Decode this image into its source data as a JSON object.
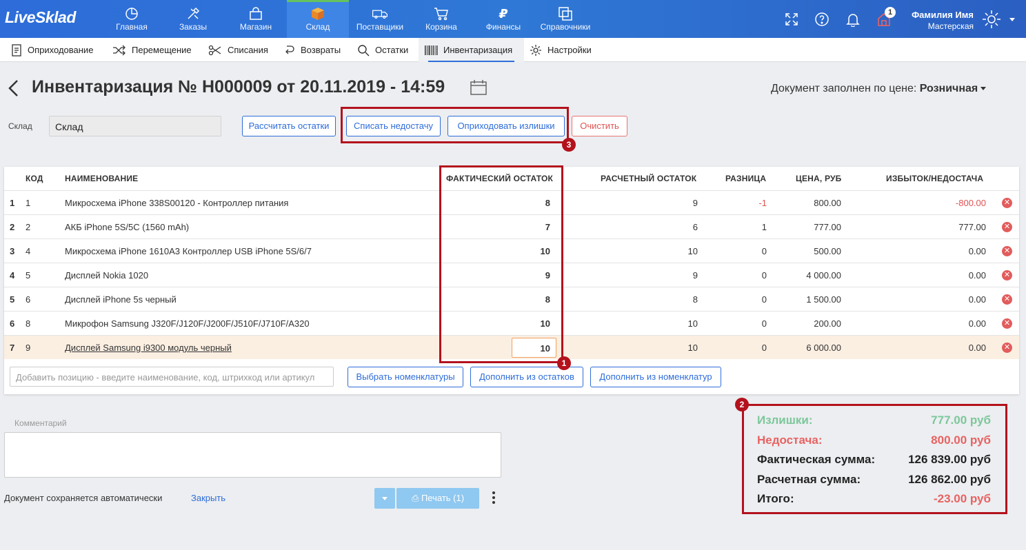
{
  "app": {
    "logo": "LiveSklad"
  },
  "nav": [
    {
      "label": "Главная",
      "icon": "chart-pie-icon"
    },
    {
      "label": "Заказы",
      "icon": "tools-icon"
    },
    {
      "label": "Магазин",
      "icon": "shopping-bag-icon"
    },
    {
      "label": "Склад",
      "icon": "box-icon",
      "active": true
    },
    {
      "label": "Поставщики",
      "icon": "truck-icon"
    },
    {
      "label": "Корзина",
      "icon": "cart-icon"
    },
    {
      "label": "Финансы",
      "icon": "ruble-icon"
    },
    {
      "label": "Справочники",
      "icon": "copy-icon"
    }
  ],
  "topright": {
    "notifications_count": "1",
    "user_name": "Фамилия Имя",
    "user_role": "Мастерская"
  },
  "subnav": [
    {
      "label": "Оприходование",
      "icon": "document-icon"
    },
    {
      "label": "Перемещение",
      "icon": "shuffle-icon"
    },
    {
      "label": "Списания",
      "icon": "scissors-icon"
    },
    {
      "label": "Возвраты",
      "icon": "return-icon"
    },
    {
      "label": "Остатки",
      "icon": "search-icon"
    },
    {
      "label": "Инвентаризация",
      "icon": "barcode-icon",
      "active": true
    },
    {
      "label": "Настройки",
      "icon": "gear-icon"
    }
  ],
  "page": {
    "title": "Инвентаризация № Н000009 от 20.11.2019 - 14:59",
    "price_label": "Документ заполнен по цене:",
    "price_value": "Розничная",
    "sklad_label": "Склад",
    "sklad_value": "Склад"
  },
  "actions": {
    "calc": "Рассчитать остатки",
    "writeoff": "Списать недостачу",
    "receive": "Оприходовать излишки",
    "clear": "Очистить"
  },
  "table": {
    "headers": {
      "code": "КОД",
      "name": "НАИМЕНОВАНИЕ",
      "actual": "ФАКТИЧЕСКИЙ ОСТАТОК",
      "calc": "РАСЧЕТНЫЙ ОСТАТОК",
      "diff": "РАЗНИЦА",
      "price": "ЦЕНА, РУБ",
      "surplus": "ИЗБЫТОК/НЕДОСТАЧА"
    },
    "rows": [
      {
        "n": "1",
        "code": "1",
        "name": "Микросхема iPhone 338S00120 - Контроллер питания",
        "actual": "8",
        "calc": "9",
        "diff": "-1",
        "price": "800.00",
        "surplus": "-800.00"
      },
      {
        "n": "2",
        "code": "2",
        "name": "АКБ iPhone 5S/5C (1560 mAh)",
        "actual": "7",
        "calc": "6",
        "diff": "1",
        "price": "777.00",
        "surplus": "777.00"
      },
      {
        "n": "3",
        "code": "4",
        "name": "Микросхема iPhone 1610A3 Контроллер USB iPhone 5S/6/7",
        "actual": "10",
        "calc": "10",
        "diff": "0",
        "price": "500.00",
        "surplus": "0.00"
      },
      {
        "n": "4",
        "code": "5",
        "name": "Дисплей Nokia 1020",
        "actual": "9",
        "calc": "9",
        "diff": "0",
        "price": "4 000.00",
        "surplus": "0.00"
      },
      {
        "n": "5",
        "code": "6",
        "name": "Дисплей iPhone 5s черный",
        "actual": "8",
        "calc": "8",
        "diff": "0",
        "price": "1 500.00",
        "surplus": "0.00"
      },
      {
        "n": "6",
        "code": "8",
        "name": "Микрофон Samsung J320F/J120F/J200F/J510F/J710F/A320",
        "actual": "10",
        "calc": "10",
        "diff": "0",
        "price": "200.00",
        "surplus": "0.00"
      },
      {
        "n": "7",
        "code": "9",
        "name": "Дисплей Samsung i9300 модуль черный",
        "actual": "10",
        "calc": "10",
        "diff": "0",
        "price": "6 000.00",
        "surplus": "0.00"
      }
    ],
    "add_placeholder": "Добавить позицию - введите наименование, код, штрихкод или артикул",
    "btn_choose": "Выбрать номенклатуры",
    "btn_fill_stock": "Дополнить из остатков",
    "btn_fill_nom": "Дополнить из номенклатур"
  },
  "markers": {
    "m1": "1",
    "m2": "2",
    "m3": "3"
  },
  "comment": {
    "label": "Комментарий"
  },
  "footer": {
    "autosave": "Документ сохраняется автоматически",
    "close": "Закрыть",
    "print": "Печать (1)"
  },
  "summary": {
    "surplus_label": "Излишки:",
    "surplus_value": "777.00 руб",
    "shortage_label": "Недостача:",
    "shortage_value": "800.00 руб",
    "actual_label": "Фактическая сумма:",
    "actual_value": "126 839.00 руб",
    "calc_label": "Расчетная сумма:",
    "calc_value": "126 862.00 руб",
    "total_label": "Итого:",
    "total_value": "-23.00 руб"
  },
  "colors": {
    "brand": "#2d6cd9",
    "highlight": "#b3121c",
    "positive": "#7cc79a",
    "negative": "#e86262"
  }
}
